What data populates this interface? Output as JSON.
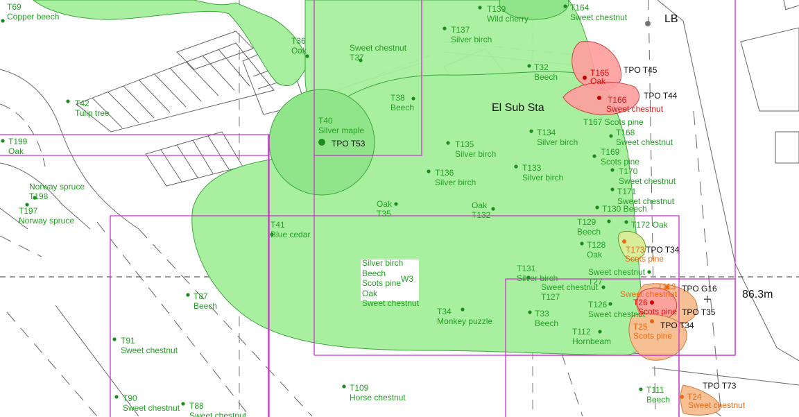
{
  "colors": {
    "canopy_fill": "#a8f0a0",
    "canopy_stroke": "#3aa53a",
    "tree_text": "#22a022",
    "tree_dot": "#1d8a1d",
    "boundary": "#cc33cc",
    "line": "#666666",
    "red_fill": "#ff9e9e",
    "red_text": "#e01010",
    "orange_fill": "#f7bf94",
    "orange_text": "#ee6a10",
    "olive_fill": "#d9ec9a",
    "black": "#111111"
  },
  "labels": {
    "substation": "El Sub Sta",
    "lb": "LB",
    "spot_height": "86.3m",
    "w3_code": "W3",
    "w3_species": [
      "Silver birch",
      "Beech",
      "Scots pine",
      "Oak",
      "Sweet chestnut"
    ]
  },
  "trees": [
    {
      "id": "T69",
      "name": "Copper beech",
      "lines": [
        "T69",
        "Copper beech"
      ]
    },
    {
      "id": "T36",
      "name": "Oak",
      "lines": [
        "T36",
        "Oak"
      ]
    },
    {
      "id": "T37",
      "name": "Sweet chestnut",
      "lines": [
        "Sweet chestnut",
        "T37"
      ]
    },
    {
      "id": "T137",
      "name": "Silver birch",
      "lines": [
        "T137",
        "Silver birch"
      ]
    },
    {
      "id": "T139",
      "name": "Wild cherry",
      "lines": [
        "T139",
        "Wild cherry"
      ]
    },
    {
      "id": "T164",
      "name": "Sweet chestnut",
      "lines": [
        "T164",
        "Sweet chestnut"
      ]
    },
    {
      "id": "T32",
      "name": "Beech",
      "lines": [
        "T32",
        "Beech"
      ]
    },
    {
      "id": "T42",
      "name": "Tulip tree",
      "lines": [
        "T42",
        "Tulip tree"
      ]
    },
    {
      "id": "T38",
      "name": "Beech",
      "lines": [
        "T38",
        "Beech"
      ]
    },
    {
      "id": "T40",
      "name": "Silver maple",
      "lines": [
        "T40",
        "Silver maple"
      ]
    },
    {
      "id": "T199",
      "name": "Oak",
      "lines": [
        "T199",
        "Oak"
      ]
    },
    {
      "id": "T135",
      "name": "Silver birch",
      "lines": [
        "T135",
        "Silver birch"
      ]
    },
    {
      "id": "T134",
      "name": "Silver birch",
      "lines": [
        "T134",
        "Silver birch"
      ]
    },
    {
      "id": "T167",
      "name": "Scots pine",
      "lines": [
        "T167 Scots pine"
      ]
    },
    {
      "id": "T168",
      "name": "Sweet chestnut",
      "lines": [
        "T168",
        "Sweet chestnut"
      ]
    },
    {
      "id": "T169",
      "name": "Scots pine",
      "lines": [
        "T169",
        "Scots pine"
      ]
    },
    {
      "id": "T136",
      "name": "Silver birch",
      "lines": [
        "T136",
        "Silver birch"
      ]
    },
    {
      "id": "T133",
      "name": "Silver birch",
      "lines": [
        "T133",
        "Silver birch"
      ]
    },
    {
      "id": "T170",
      "name": "Sweet chestnut",
      "lines": [
        "T170",
        "Sweet chestnut"
      ]
    },
    {
      "id": "T171",
      "name": "Sweet chestnut",
      "lines": [
        "T171",
        "Sweet chestnut"
      ]
    },
    {
      "id": "T198",
      "name": "Norway spruce",
      "lines": [
        "Norway spruce",
        "T198"
      ]
    },
    {
      "id": "T197",
      "name": "Norway spruce",
      "lines": [
        "T197",
        "Norway spruce"
      ]
    },
    {
      "id": "T35",
      "name": "Oak",
      "lines": [
        "Oak",
        "T35"
      ]
    },
    {
      "id": "T132",
      "name": "Oak",
      "lines": [
        "Oak",
        "T132"
      ]
    },
    {
      "id": "T130",
      "name": "Beech",
      "lines": [
        "T130 Beech"
      ]
    },
    {
      "id": "T41",
      "name": "Blue cedar",
      "lines": [
        "T41",
        "Blue cedar"
      ]
    },
    {
      "id": "T129",
      "name": "Beech",
      "lines": [
        "T129",
        "Beech"
      ]
    },
    {
      "id": "T172",
      "name": "Oak",
      "lines": [
        "T172 Oak"
      ]
    },
    {
      "id": "T128",
      "name": "Oak",
      "lines": [
        "T128",
        "Oak"
      ]
    },
    {
      "id": "T131",
      "name": "Silver birch",
      "lines": [
        "T131",
        "Silver birch"
      ]
    },
    {
      "id": "T27",
      "name": "Sweet chestnut",
      "lines": [
        "Sweet chestnut",
        "T27"
      ]
    },
    {
      "id": "T127",
      "name": "Sweet chestnut",
      "lines": [
        "Sweet chestnut",
        "T127"
      ]
    },
    {
      "id": "T87",
      "name": "Beech",
      "lines": [
        "T87",
        "Beech"
      ]
    },
    {
      "id": "T126",
      "name": "Sweet chestnut",
      "lines": [
        "T126",
        "Sweet chestnut"
      ]
    },
    {
      "id": "T34",
      "name": "Monkey puzzle",
      "lines": [
        "T34",
        "Monkey puzzle"
      ]
    },
    {
      "id": "T33",
      "name": "Beech",
      "lines": [
        "T33",
        "Beech"
      ]
    },
    {
      "id": "T112",
      "name": "Hornbeam",
      "lines": [
        "T112",
        "Hornbeam"
      ]
    },
    {
      "id": "T91",
      "name": "Sweet chestnut",
      "lines": [
        "T91",
        "Sweet chestnut"
      ]
    },
    {
      "id": "T109",
      "name": "Horse chestnut",
      "lines": [
        "T109",
        "Horse chestnut"
      ]
    },
    {
      "id": "T111",
      "name": "Beech",
      "lines": [
        "T111",
        "Beech"
      ]
    },
    {
      "id": "T90",
      "name": "Sweet chestnut",
      "lines": [
        "T90",
        "Sweet chestnut"
      ]
    },
    {
      "id": "T88",
      "name": "Sweet chestnut",
      "lines": [
        "T88",
        "Sweet chestnut"
      ]
    }
  ],
  "tpo_trees": [
    {
      "id": "T165",
      "name": "Oak",
      "tpo": "TPO T45",
      "status": "red"
    },
    {
      "id": "T166",
      "name": "Sweet chestnut",
      "tpo": "TPO T44",
      "status": "red"
    },
    {
      "id": "T173",
      "name": "Scots pine",
      "tpo": "TPO T34",
      "status": "orange"
    },
    {
      "id": "T113",
      "name": "Sweet chestnut",
      "tpo": "TPO G16",
      "status": "orange"
    },
    {
      "id": "T26",
      "name": "Scots pine",
      "tpo": "TPO T35",
      "status": "red"
    },
    {
      "id": "T25",
      "name": "Scots pine",
      "tpo": "TPO T34",
      "status": "orange"
    },
    {
      "id": "T24",
      "name": "Sweet chestnut",
      "tpo": "TPO T73",
      "status": "orange"
    }
  ],
  "tpo_labels": {
    "t40": "TPO T53"
  }
}
